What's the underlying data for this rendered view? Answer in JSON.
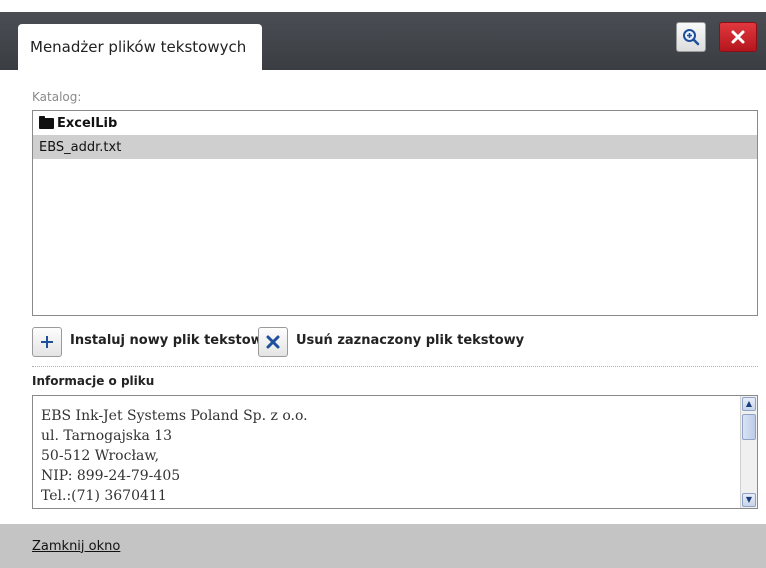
{
  "window": {
    "tab_title": "Menadżer plików tekstowych",
    "zoom_icon": "zoom-in-icon",
    "close_icon": "close-icon",
    "colors": {
      "header_bg": "#3f4247",
      "close_bg": "#c9222a",
      "selected_row": "#cfcfcf",
      "footer_bg": "#c4c4c4"
    }
  },
  "catalog": {
    "label": "Katalog:",
    "items": [
      {
        "name": "ExcelLib",
        "type": "folder",
        "icon": "folder-icon",
        "selected": false
      },
      {
        "name": "EBS_addr.txt",
        "type": "file",
        "selected": true
      }
    ]
  },
  "actions": {
    "install_label": "Instaluj nowy plik tekstowy",
    "install_icon": "plus-icon",
    "remove_label": "Usuń zaznaczony plik tekstowy",
    "remove_icon": "x-icon"
  },
  "file_info": {
    "label": "Informacje o pliku",
    "lines": [
      "EBS Ink-Jet Systems Poland Sp. z o.o.",
      "ul. Tarnogajska 13",
      "50-512 Wrocław,",
      "NIP: 899-24-79-405",
      "Tel.:(71) 3670411"
    ]
  },
  "footer": {
    "close_link": "Zamknij okno"
  }
}
